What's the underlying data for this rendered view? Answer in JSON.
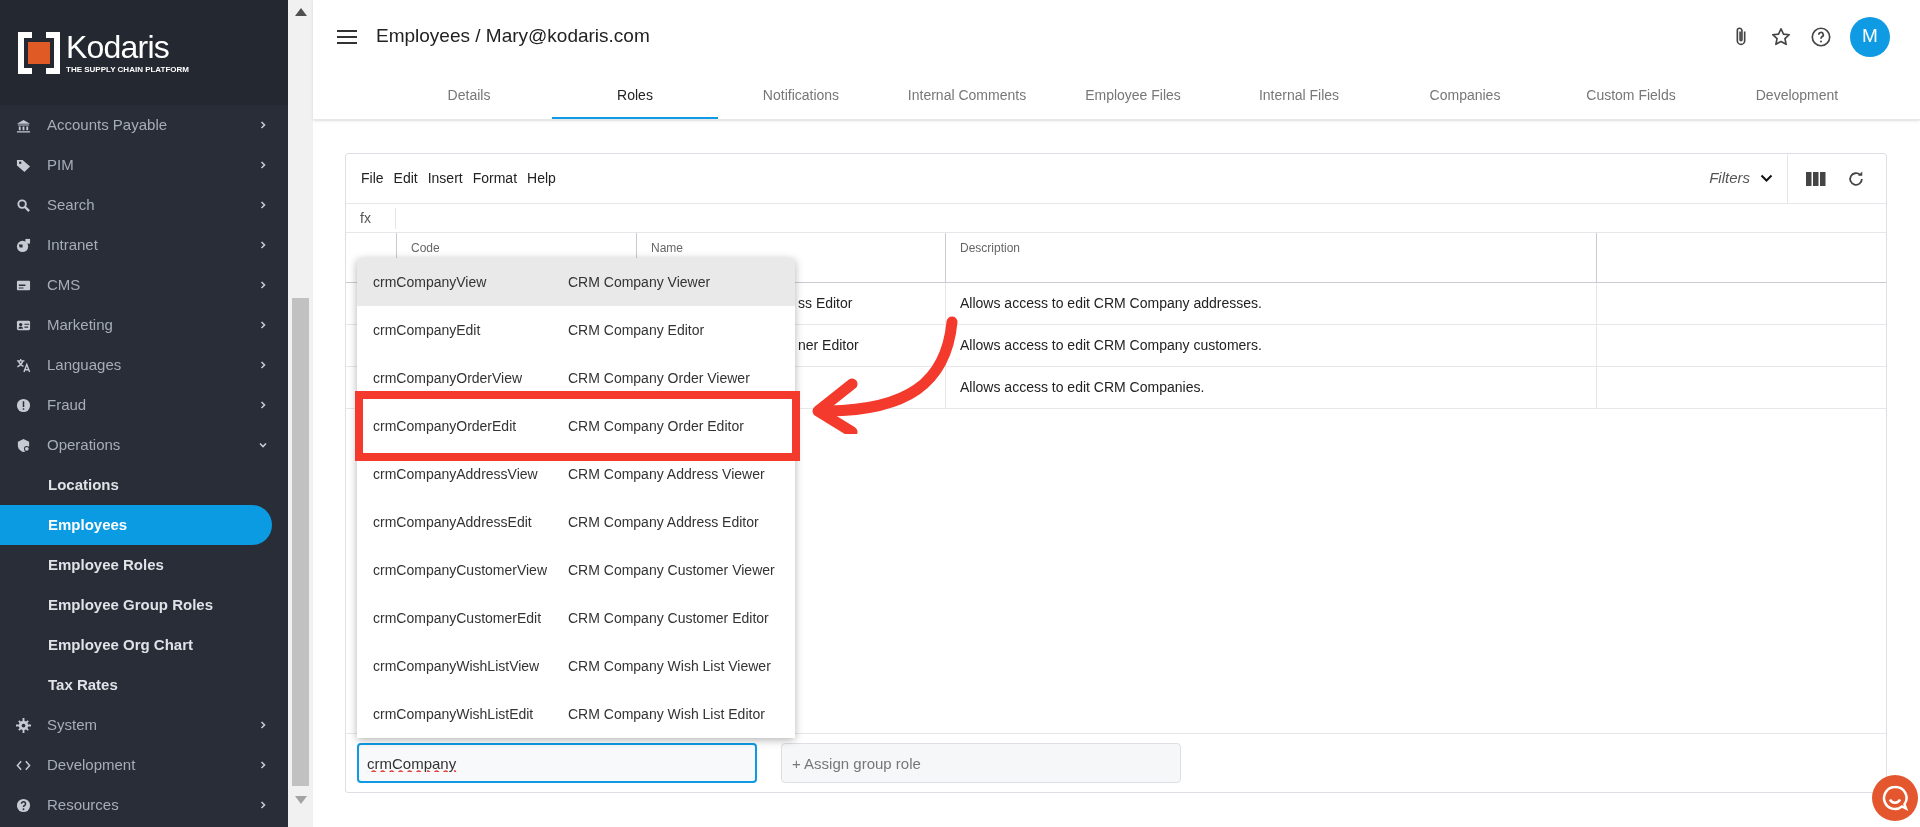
{
  "sidebar": {
    "logo": {
      "name": "Kodaris",
      "tagline": "THE SUPPLY CHAIN PLATFORM"
    },
    "items": [
      {
        "label": "Accounts Payable",
        "expanded": false
      },
      {
        "label": "PIM",
        "expanded": false
      },
      {
        "label": "Search",
        "expanded": false
      },
      {
        "label": "Intranet",
        "expanded": false
      },
      {
        "label": "CMS",
        "expanded": false
      },
      {
        "label": "Marketing",
        "expanded": false
      },
      {
        "label": "Languages",
        "expanded": false
      },
      {
        "label": "Fraud",
        "expanded": false
      },
      {
        "label": "Operations",
        "expanded": true,
        "children": [
          {
            "label": "Locations",
            "selected": false
          },
          {
            "label": "Employees",
            "selected": true
          },
          {
            "label": "Employee Roles",
            "selected": false
          },
          {
            "label": "Employee Group Roles",
            "selected": false
          },
          {
            "label": "Employee Org Chart",
            "selected": false
          },
          {
            "label": "Tax Rates",
            "selected": false
          }
        ]
      },
      {
        "label": "System",
        "expanded": false
      },
      {
        "label": "Development",
        "expanded": false
      },
      {
        "label": "Resources",
        "expanded": false
      }
    ]
  },
  "header": {
    "title": "Employees / Mary@kodaris.com",
    "avatar": "M"
  },
  "tabs": [
    {
      "label": "Details",
      "selected": false
    },
    {
      "label": "Roles",
      "selected": true
    },
    {
      "label": "Notifications",
      "selected": false
    },
    {
      "label": "Internal Comments",
      "selected": false
    },
    {
      "label": "Employee Files",
      "selected": false
    },
    {
      "label": "Internal Files",
      "selected": false
    },
    {
      "label": "Companies",
      "selected": false
    },
    {
      "label": "Custom Fields",
      "selected": false
    },
    {
      "label": "Development",
      "selected": false
    }
  ],
  "toolbar": {
    "menus": [
      "File",
      "Edit",
      "Insert",
      "Format",
      "Help"
    ],
    "filters": "Filters",
    "formula_label": "fx"
  },
  "table": {
    "columns": [
      "Code",
      "Name",
      "Description"
    ],
    "rows": [
      {
        "name": "ss Editor",
        "description": "Allows access to edit CRM Company addresses."
      },
      {
        "name": "ner Editor",
        "description": "Allows access to edit CRM Company customers."
      },
      {
        "description": "Allows access to edit CRM Companies."
      }
    ]
  },
  "dropdown": {
    "items": [
      {
        "code": "crmCompanyView",
        "name": "CRM Company Viewer",
        "selected": true,
        "boxed": false
      },
      {
        "code": "crmCompanyEdit",
        "name": "CRM Company Editor",
        "selected": false,
        "boxed": false
      },
      {
        "code": "crmCompanyOrderView",
        "name": "CRM Company Order Viewer",
        "selected": false,
        "boxed": false
      },
      {
        "code": "crmCompanyOrderEdit",
        "name": "CRM Company Order Editor",
        "selected": false,
        "boxed": true
      },
      {
        "code": "crmCompanyAddressView",
        "name": "CRM Company Address Viewer",
        "selected": false,
        "boxed": false
      },
      {
        "code": "crmCompanyAddressEdit",
        "name": "CRM Company Address Editor",
        "selected": false,
        "boxed": false
      },
      {
        "code": "crmCompanyCustomerView",
        "name": "CRM Company Customer Viewer",
        "selected": false,
        "boxed": false
      },
      {
        "code": "crmCompanyCustomerEdit",
        "name": "CRM Company Customer Editor",
        "selected": false,
        "boxed": false
      },
      {
        "code": "crmCompanyWishListView",
        "name": "CRM Company Wish List Viewer",
        "selected": false,
        "boxed": false
      },
      {
        "code": "crmCompanyWishListEdit",
        "name": "CRM Company Wish List Editor",
        "selected": false,
        "boxed": false
      }
    ],
    "annotation_arrow": true
  },
  "role_input": {
    "value": "crmCompany"
  },
  "group_role_input": {
    "placeholder": "+ Assign group role"
  }
}
